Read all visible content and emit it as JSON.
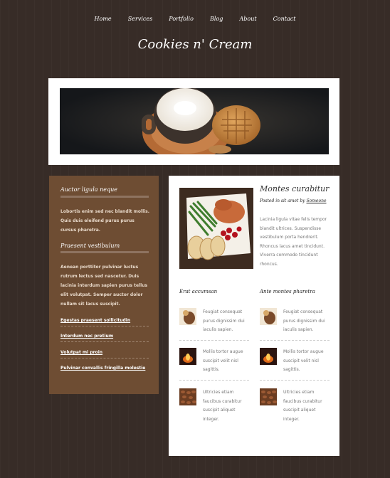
{
  "nav": {
    "home": "Home",
    "services": "Services",
    "portfolio": "Portfolio",
    "blog": "Blog",
    "about": "About",
    "contact": "Contact"
  },
  "site": {
    "title": "Cookies n' Cream"
  },
  "sidebar": {
    "heading1": "Auctor ligula neque",
    "text1": "Lobortis enim sed nec blandit mollis. Quis duis eleifend purus purus cursus pharetra.",
    "heading2": "Praesent vestibulum",
    "text2": "Aenean porttitor pulvinar luctus rutrum lectus sed nascetur. Duis lacinia interdum sapien purus tellus elit volutpat. Semper auctor dolor nullam sit lacus suscipit.",
    "links": [
      "Egestas praesent sollicitudin",
      "Interdum nec pretium",
      "Volutpat mi proin",
      "Pulvinar convallis fringilla molestie"
    ]
  },
  "post": {
    "title": "Montes curabitur",
    "meta_prefix": "Posted in sit amet by",
    "author": "Someone",
    "body": "Lacinia ligula vitae felis tempor blandit ultrices. Suspendisse vestibulum porta hendrerit. Rhoncus lacus amet tincidunt. Viverra commodo tincidunt rhoncus."
  },
  "columns": [
    {
      "heading": "Erat accumsan",
      "items": [
        "Feugiat consequat purus dignissim dui iaculis sapien.",
        "Mollis tortor augue suscipit velit nisl sagittis.",
        "Ultricies etiam faucibus curabitur suscipit aliquet integer."
      ]
    },
    {
      "heading": "Ante montes pharetra",
      "items": [
        "Feugiat consequat purus dignissim dui iaculis sapien.",
        "Mollis tortor augue suscipit velit nisl sagittis.",
        "Ultricies etiam faucibus curabitur suscipit aliquet integer."
      ]
    }
  ]
}
